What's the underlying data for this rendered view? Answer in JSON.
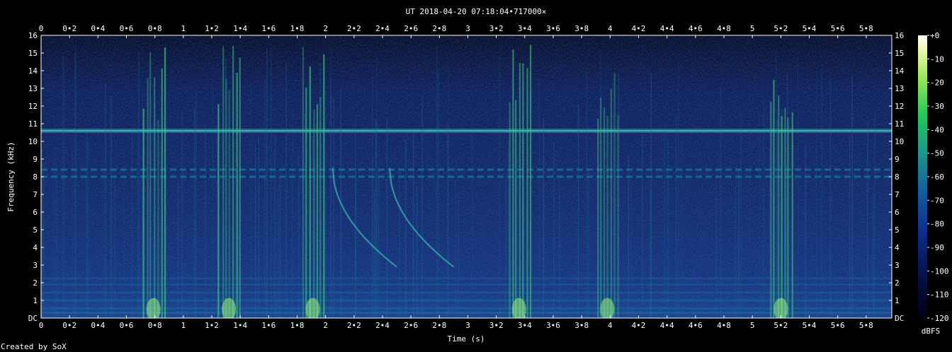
{
  "chart_data": {
    "type": "heatmap",
    "title": "UT 2018-04-20 07:18:04•717000×",
    "xlabel": "Time (s)",
    "ylabel": "Frequency (kHz)",
    "xlim": [
      0,
      5.98
    ],
    "ylim": [
      0,
      16
    ],
    "x_ticks": [
      "0",
      "0•2",
      "0•4",
      "0•6",
      "0•8",
      "1",
      "1•2",
      "1•4",
      "1•6",
      "1•8",
      "2",
      "2•2",
      "2•4",
      "2•6",
      "2•8",
      "3",
      "3•2",
      "3•4",
      "3•6",
      "3•8",
      "4",
      "4•2",
      "4•4",
      "4•6",
      "4•8",
      "5",
      "5•2",
      "5•4",
      "5•6",
      "5•8"
    ],
    "y_ticks": [
      "DC",
      "1",
      "2",
      "3",
      "4",
      "5",
      "6",
      "7",
      "8",
      "9",
      "10",
      "11",
      "12",
      "13",
      "14",
      "15",
      "16"
    ],
    "colorbar": {
      "label": "dBFS",
      "ticks": [
        "+0",
        "-10",
        "-20",
        "-30",
        "-40",
        "-50",
        "-60",
        "-70",
        "-80",
        "-90",
        "-100",
        "-110",
        "-120"
      ],
      "range": [
        -120,
        0
      ]
    },
    "features": {
      "horizontal_tones_khz": [
        10.6,
        8.4,
        8.0
      ],
      "bursts_s": [
        0.79,
        1.32,
        1.91,
        3.36,
        3.98,
        5.2
      ],
      "whistler_start_s": [
        2.05,
        2.45
      ]
    },
    "colors": {
      "background": "#0a1a4a",
      "low": "#0b2a70",
      "mid": "#1a6e9a",
      "high": "#3ec77a",
      "peak": "#a6ff7a"
    }
  },
  "credit": "Created by SoX"
}
